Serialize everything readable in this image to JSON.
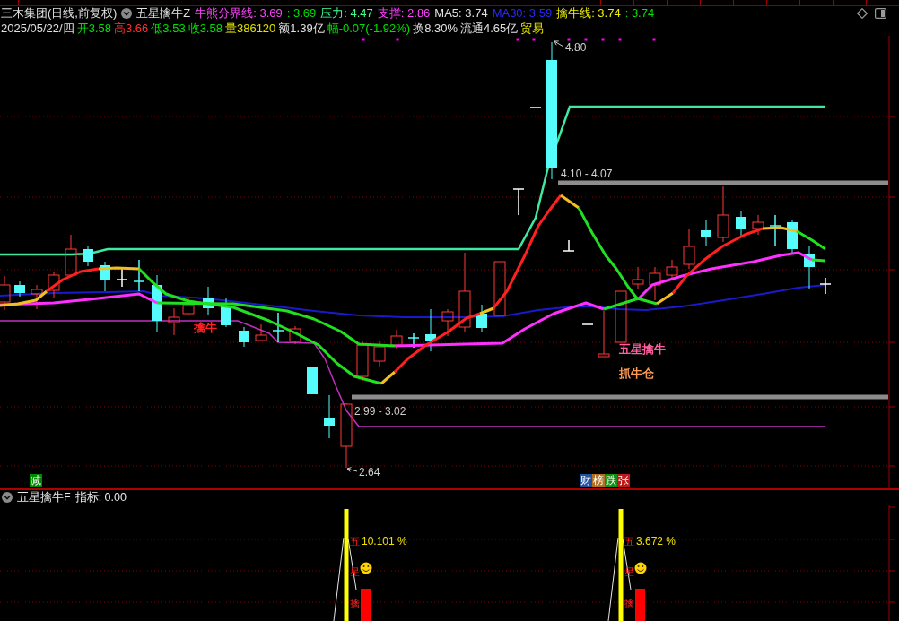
{
  "header": {
    "security": "三木集团(日线,前复权)",
    "indicator": "五星擒牛Z",
    "readouts": [
      {
        "text": "牛熊分界线: 3.69",
        "color": "#ff44ff"
      },
      {
        "text": ": 3.69",
        "color": "#00e000"
      },
      {
        "text": "压力: 4.47",
        "color": "#40ff90"
      },
      {
        "text": "支撑: 2.86",
        "color": "#ff44ff"
      },
      {
        "text": "MA5: 3.74",
        "color": "#e0e0e0"
      },
      {
        "text": "MA30: 3.59",
        "color": "#2828ff"
      },
      {
        "text": "擒牛线: 3.74",
        "color": "#f0f000"
      },
      {
        "text": ": 3.74",
        "color": "#00e000"
      }
    ]
  },
  "quote": {
    "items": [
      {
        "text": "2025/05/22/四",
        "color": "#e0e0e0"
      },
      {
        "text": "开3.58",
        "color": "#00e000"
      },
      {
        "text": "高3.66",
        "color": "#ff3232"
      },
      {
        "text": "低3.53",
        "color": "#00e000"
      },
      {
        "text": "收3.58",
        "color": "#00e000"
      },
      {
        "text": "量386120",
        "color": "#e0e000"
      },
      {
        "text": "额1.39亿",
        "color": "#e0e0e0"
      },
      {
        "text": "幅-0.07(-1.92%)",
        "color": "#00e000"
      },
      {
        "text": "换8.30%",
        "color": "#e0e0e0"
      },
      {
        "text": "流通4.65亿",
        "color": "#e0e0e0"
      },
      {
        "text": "贸易",
        "color": "#e0e000"
      }
    ]
  },
  "main_chart": {
    "annotations": [
      {
        "kind": "price",
        "text": "4.80"
      },
      {
        "kind": "range",
        "text": "4.10 - 4.07"
      },
      {
        "kind": "range",
        "text": "2.99 - 3.02"
      },
      {
        "kind": "price",
        "text": "2.64"
      },
      {
        "kind": "signal",
        "text": "擒牛",
        "color": "#ff2020"
      },
      {
        "kind": "signal",
        "text": "五星擒牛",
        "color": "#ff5fa0"
      },
      {
        "kind": "signal",
        "text": "抓牛仓",
        "color": "#ff9a50"
      }
    ],
    "badge_groups": [
      {
        "items": [
          {
            "text": "减",
            "color": "#008800"
          }
        ]
      },
      {
        "items": [
          {
            "text": "财",
            "color": "#2050a0"
          },
          {
            "text": "榜",
            "color": "#b07020"
          },
          {
            "text": "跌",
            "color": "#109010"
          },
          {
            "text": "张",
            "color": "#c01818"
          }
        ]
      }
    ]
  },
  "sub_panel": {
    "title": "五星擒牛F",
    "reading": "指标: 0.00",
    "signals": [
      {
        "percent": "10.101 %",
        "marks": [
          "五",
          "星",
          "擒"
        ]
      },
      {
        "percent": "3.672 %",
        "marks": [
          "五",
          "星",
          "擒"
        ]
      }
    ]
  }
}
